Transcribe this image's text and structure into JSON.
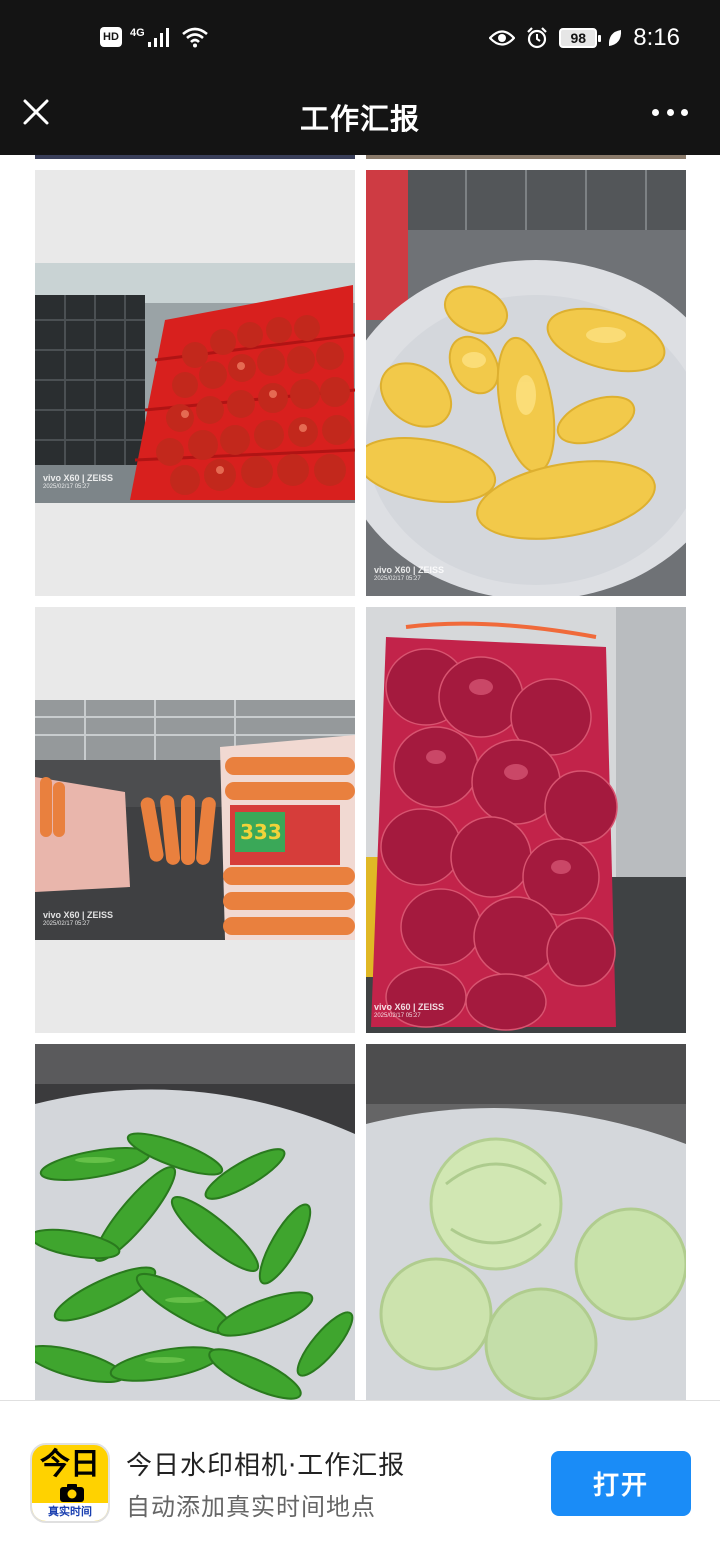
{
  "status_bar": {
    "hd_badge": "HD",
    "network": "4G",
    "battery": "98",
    "time": "8:16"
  },
  "title_bar": {
    "title": "工作汇报"
  },
  "photos": [
    {
      "subject": "tomatoes",
      "watermark_brand": "vivo X60 | ZEISS",
      "watermark_date": "2025/02/17 05:27"
    },
    {
      "subject": "corn",
      "watermark_brand": "vivo X60 | ZEISS",
      "watermark_date": "2025/02/17 05:27"
    },
    {
      "subject": "carrots",
      "watermark_brand": "vivo X60 | ZEISS",
      "watermark_date": "2025/02/17 05:27",
      "bag_label": "333"
    },
    {
      "subject": "red-onions",
      "watermark_brand": "vivo X60 | ZEISS",
      "watermark_date": "2025/02/17 05:27"
    },
    {
      "subject": "green-peppers"
    },
    {
      "subject": "cabbage"
    }
  ],
  "banner": {
    "icon_top": "今日",
    "icon_bottom": "真实时间",
    "app_name": "今日水印相机·工作汇报",
    "tagline": "自动添加真实时间地点",
    "open_label": "打开"
  },
  "colors": {
    "bar_background": "#141414",
    "open_button": "#1a8cf7",
    "icon_yellow": "#ffd200"
  }
}
